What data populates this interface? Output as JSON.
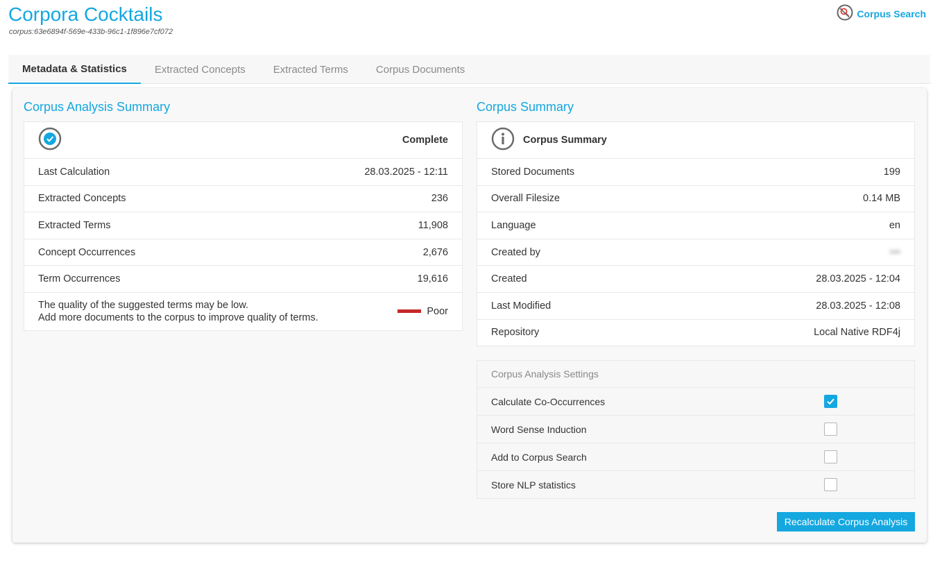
{
  "header": {
    "title": "Corpora Cocktails",
    "corpus_id": "corpus:63e6894f-569e-433b-96c1-1f896e7cf072",
    "corpus_search_label": "Corpus Search"
  },
  "tabs": [
    {
      "label": "Metadata & Statistics",
      "active": true
    },
    {
      "label": "Extracted Concepts",
      "active": false
    },
    {
      "label": "Extracted Terms",
      "active": false
    },
    {
      "label": "Corpus Documents",
      "active": false
    }
  ],
  "analysis_summary": {
    "title": "Corpus Analysis Summary",
    "status": "Complete",
    "rows": [
      {
        "label": "Last Calculation",
        "value": "28.03.2025 - 12:11"
      },
      {
        "label": "Extracted Concepts",
        "value": "236"
      },
      {
        "label": "Extracted Terms",
        "value": "11,908"
      },
      {
        "label": "Concept Occurrences",
        "value": "2,676"
      },
      {
        "label": "Term Occurrences",
        "value": "19,616"
      }
    ],
    "quality": {
      "line1": "The quality of the suggested terms may be low.",
      "line2": "Add more documents to the corpus to improve quality of terms.",
      "rating": "Poor"
    }
  },
  "corpus_summary": {
    "title": "Corpus Summary",
    "card_title": "Corpus Summary",
    "rows": [
      {
        "label": "Stored Documents",
        "value": "199"
      },
      {
        "label": "Overall Filesize",
        "value": "0.14 MB"
      },
      {
        "label": "Language",
        "value": "en"
      },
      {
        "label": "Created by",
        "value": "•••"
      },
      {
        "label": "Created",
        "value": "28.03.2025 - 12:04"
      },
      {
        "label": "Last Modified",
        "value": "28.03.2025 - 12:08"
      },
      {
        "label": "Repository",
        "value": "Local Native RDF4j"
      }
    ]
  },
  "settings": {
    "title": "Corpus Analysis Settings",
    "items": [
      {
        "label": "Calculate Co-Occurrences",
        "checked": true
      },
      {
        "label": "Word Sense Induction",
        "checked": false
      },
      {
        "label": "Add to Corpus Search",
        "checked": false
      },
      {
        "label": "Store NLP statistics",
        "checked": false
      }
    ]
  },
  "recalculate_button": "Recalculate Corpus Analysis",
  "colors": {
    "accent": "#14a7e0",
    "poor": "#c62828"
  }
}
